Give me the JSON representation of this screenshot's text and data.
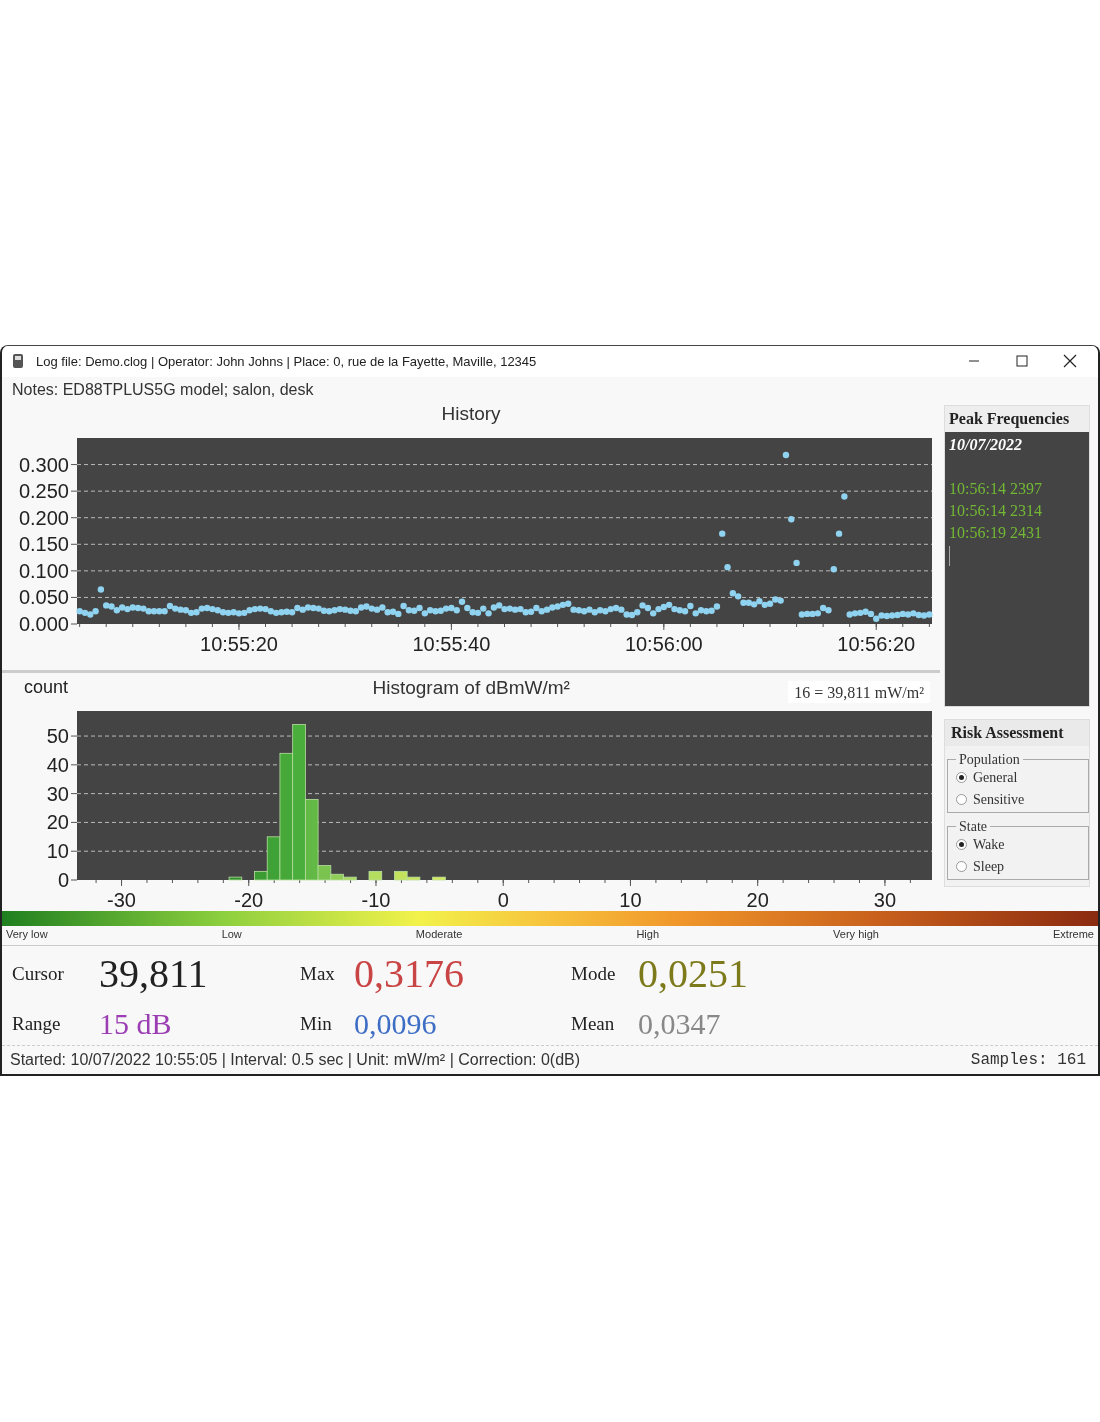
{
  "window": {
    "title": "Log file: Demo.clog | Operator: John Johns | Place: 0, rue de la Fayette, Maville, 12345"
  },
  "notes": "Notes: ED88TPLUS5G model; salon, desk",
  "history": {
    "chart_data": {
      "type": "scatter",
      "title": "History",
      "grid": true,
      "ylim": [
        0,
        0.35
      ],
      "categories": [
        null,
        null,
        null,
        null,
        null,
        null,
        null,
        null,
        null,
        null,
        null,
        null,
        null,
        null,
        null,
        null,
        null,
        null,
        null,
        null,
        null,
        null,
        null,
        null,
        null,
        null,
        null,
        null,
        null,
        null,
        "10:55:20",
        null,
        null,
        null,
        null,
        null,
        null,
        null,
        null,
        null,
        null,
        null,
        null,
        null,
        null,
        null,
        null,
        null,
        null,
        null,
        null,
        null,
        null,
        null,
        null,
        null,
        null,
        null,
        null,
        null,
        null,
        null,
        null,
        null,
        null,
        null,
        null,
        null,
        null,
        null,
        "10:55:40",
        null,
        null,
        null,
        null,
        null,
        null,
        null,
        null,
        null,
        null,
        null,
        null,
        null,
        null,
        null,
        null,
        null,
        null,
        null,
        null,
        null,
        null,
        null,
        null,
        null,
        null,
        null,
        null,
        null,
        null,
        null,
        null,
        null,
        null,
        null,
        null,
        null,
        null,
        null,
        "10:56:00",
        null,
        null,
        null,
        null,
        null,
        null,
        null,
        null,
        null,
        null,
        null,
        null,
        null,
        null,
        null,
        null,
        null,
        null,
        null,
        null,
        null,
        null,
        null,
        null,
        null,
        null,
        null,
        null,
        null,
        null,
        null,
        null,
        null,
        null,
        null,
        null,
        null,
        null,
        null,
        "10:56:20",
        null,
        null,
        null,
        null,
        null,
        null,
        null,
        null,
        null,
        null
      ],
      "yticks": [
        {
          "value": 0,
          "label": "0.000"
        },
        {
          "value": 0.05,
          "label": "0.050"
        },
        {
          "value": 0.1,
          "label": "0.100"
        },
        {
          "value": 0.15,
          "label": "0.150"
        },
        {
          "value": 0.2,
          "label": "0.200"
        },
        {
          "value": 0.25,
          "label": "0.250"
        },
        {
          "value": 0.3,
          "label": "0.300"
        }
      ],
      "series": [
        {
          "color": "#8fd3f0",
          "values": [
            0.024,
            0.021,
            0.018,
            0.024,
            0.065,
            0.035,
            0.033,
            0.026,
            0.031,
            0.028,
            0.031,
            0.03,
            0.029,
            0.024,
            0.024,
            0.024,
            0.024,
            0.034,
            0.029,
            0.027,
            0.026,
            0.021,
            0.022,
            0.029,
            0.03,
            0.028,
            0.026,
            0.022,
            0.021,
            0.022,
            0.02,
            0.021,
            0.026,
            0.028,
            0.029,
            0.028,
            0.024,
            0.021,
            0.022,
            0.023,
            0.022,
            0.03,
            0.027,
            0.031,
            0.03,
            0.029,
            0.025,
            0.024,
            0.026,
            0.028,
            0.027,
            0.025,
            0.024,
            0.031,
            0.033,
            0.029,
            0.027,
            0.031,
            0.022,
            0.023,
            0.019,
            0.034,
            0.026,
            0.025,
            0.03,
            0.02,
            0.026,
            0.024,
            0.025,
            0.029,
            0.03,
            0.026,
            0.042,
            0.03,
            0.022,
            0.021,
            0.029,
            0.02,
            0.031,
            0.035,
            0.028,
            0.029,
            0.027,
            0.028,
            0.022,
            0.023,
            0.03,
            0.024,
            0.027,
            0.031,
            0.033,
            0.036,
            0.038,
            0.027,
            0.026,
            0.024,
            0.027,
            0.022,
            0.026,
            0.024,
            0.028,
            0.03,
            0.027,
            0.018,
            0.017,
            0.022,
            0.035,
            0.03,
            0.02,
            0.028,
            0.032,
            0.036,
            0.028,
            0.026,
            0.024,
            0.034,
            0.02,
            0.026,
            0.024,
            0.025,
            0.033,
            0.17,
            0.107,
            0.058,
            0.052,
            0.04,
            0.04,
            0.037,
            0.043,
            0.036,
            0.038,
            0.046,
            0.044,
            0.318,
            0.197,
            0.115,
            0.018,
            0.019,
            0.019,
            0.02,
            0.03,
            0.026,
            0.103,
            0.17,
            0.24,
            0.018,
            0.02,
            0.021,
            0.023,
            0.019,
            0.01,
            0.016,
            0.015,
            0.016,
            0.017,
            0.019,
            0.018,
            0.02,
            0.017,
            0.016,
            0.018
          ]
        }
      ]
    }
  },
  "histogram": {
    "cursor_readout": "16 = 39,811 mW/m²",
    "chart_data": {
      "type": "bar",
      "title": "Histogram of dBmW/m²",
      "ylabel": "count",
      "grid": true,
      "xlim": [
        -33.5,
        33.7
      ],
      "ylim": [
        0,
        58.7
      ],
      "xticks": [
        -30,
        -20,
        -10,
        0,
        10,
        20,
        30
      ],
      "yticks": [
        0,
        10,
        20,
        30,
        40,
        50
      ],
      "x": [
        -21,
        -19,
        -18,
        -17,
        -16,
        -15,
        -14,
        -13,
        -12,
        -10,
        -8,
        -7,
        -5
      ],
      "values": [
        1,
        3,
        15,
        44,
        54,
        28,
        5,
        2,
        1,
        3,
        3,
        1,
        1
      ]
    }
  },
  "peak_frequencies": {
    "title": "Peak Frequencies",
    "date": "10/07/2022",
    "entries": [
      "10:56:14 2397",
      "10:56:14 2314",
      "10:56:19 2431"
    ]
  },
  "risk_assessment": {
    "title": "Risk Assessment",
    "groups": [
      {
        "legend": "Population",
        "options": [
          {
            "label": "General",
            "selected": true
          },
          {
            "label": "Sensitive",
            "selected": false
          }
        ]
      },
      {
        "legend": "State",
        "options": [
          {
            "label": "Wake",
            "selected": true
          },
          {
            "label": "Sleep",
            "selected": false
          }
        ]
      }
    ]
  },
  "risk_scale": [
    "Very low",
    "Low",
    "Moderate",
    "High",
    "Very high",
    "Extreme"
  ],
  "stats": [
    {
      "label": "Cursor",
      "value": "39,811",
      "color": "#222222"
    },
    {
      "label": "Max",
      "value": "0,3176",
      "color": "#c94444"
    },
    {
      "label": "Mode",
      "value": "0,0251",
      "color": "#7d7a1c"
    },
    {
      "label": "Range",
      "value": "15 dB",
      "color": "#9b3db3"
    },
    {
      "label": "Min",
      "value": "0,0096",
      "color": "#3d6dc4"
    },
    {
      "label": "Mean",
      "value": "0,0347",
      "color": "#888888"
    }
  ],
  "status": {
    "text": "Started: 10/07/2022 10:55:05 | Interval: 0.5 sec | Unit: mW/m² | Correction: 0(dB)",
    "samples": "Samples: 161"
  }
}
